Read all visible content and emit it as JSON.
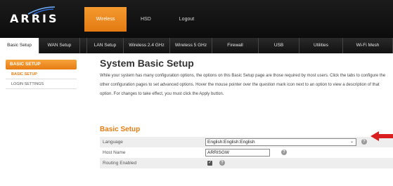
{
  "brand": {
    "logo_text": "ARRIS"
  },
  "top_nav": {
    "items": [
      "Wireless",
      "HSD",
      "Logout"
    ]
  },
  "tabs": [
    "Basic Setup",
    "WAN Setup",
    "LAN Setup",
    "Wireless 2.4 GHz",
    "Wireless 5 GHz",
    "Firewall",
    "USB",
    "Utilities",
    "Wi-Fi Mesh"
  ],
  "sidebar": {
    "header": "BASIC SETUP",
    "items": [
      "BASIC SETUP",
      "LOGIN SETTINGS"
    ]
  },
  "main": {
    "title": "System Basic Setup",
    "intro": "While your system has many configuration options, the options on this Basic Setup page are those required by most users. Click the tabs to configure the other configuration pages to set advanced options. Hover the mouse pointer over the question mark icon next to an option to view a description of that option. For changes to take effect, you must click the Apply button.",
    "section_title": "Basic Setup",
    "language": {
      "label": "Language",
      "value": "English:English:English"
    },
    "host_name": {
      "label": "Host Name",
      "value": "ARRISGW"
    },
    "routing": {
      "label": "Routing Enabled",
      "checked": true
    }
  },
  "colors": {
    "accent": "#e67c12",
    "annotation_arrow": "#d81e1e"
  },
  "icons": {
    "help": "question-mark-icon",
    "dropdown": "chevron-down-icon",
    "callout": "red-arrow-icon"
  }
}
